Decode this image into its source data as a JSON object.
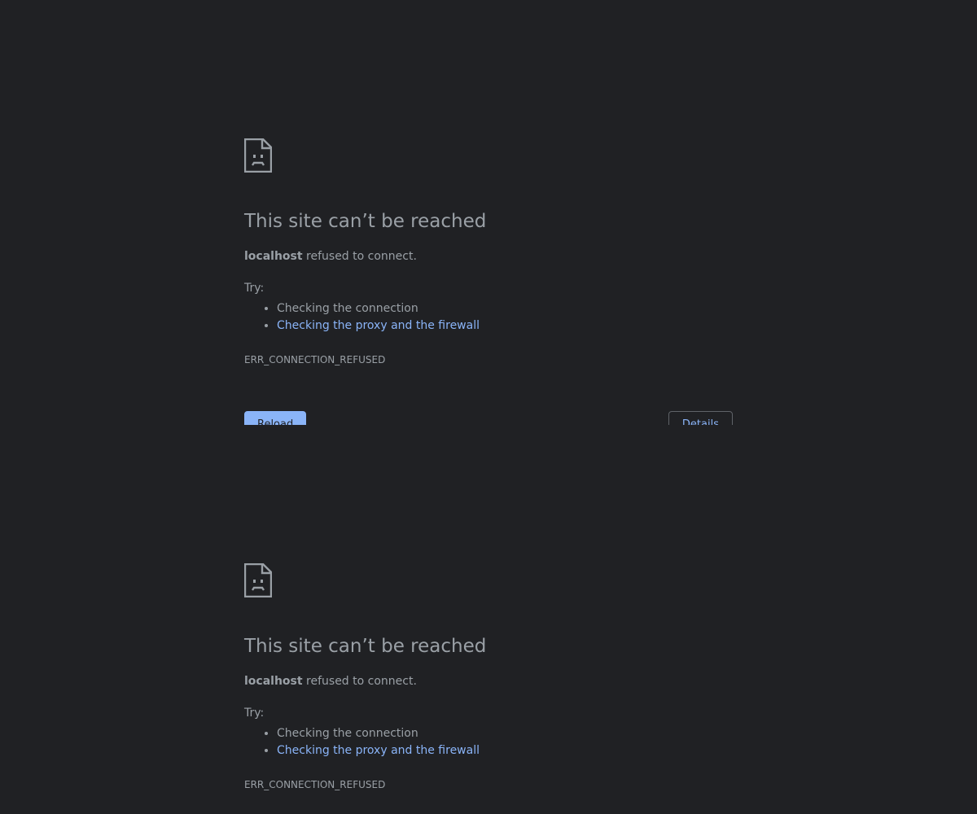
{
  "pages": [
    {
      "icon": "sad-page-icon",
      "title": "This site can’t be reached",
      "host": "localhost",
      "summary_rest": "refused to connect.",
      "try_label": "Try:",
      "suggestions": [
        "Checking the connection",
        "Checking the proxy and the firewall"
      ],
      "error_code": "ERR_CONNECTION_REFUSED",
      "reload_label": "Reload",
      "details_label": "Details"
    },
    {
      "icon": "sad-page-icon",
      "title": "This site can’t be reached",
      "host": "localhost",
      "summary_rest": "refused to connect.",
      "try_label": "Try:",
      "suggestions": [
        "Checking the connection",
        "Checking the proxy and the firewall"
      ],
      "error_code": "ERR_CONNECTION_REFUSED"
    }
  ],
  "colors": {
    "background": "#202124",
    "text": "#9aa0a6",
    "link": "#8ab4f8",
    "button": "#8ab4f8"
  }
}
